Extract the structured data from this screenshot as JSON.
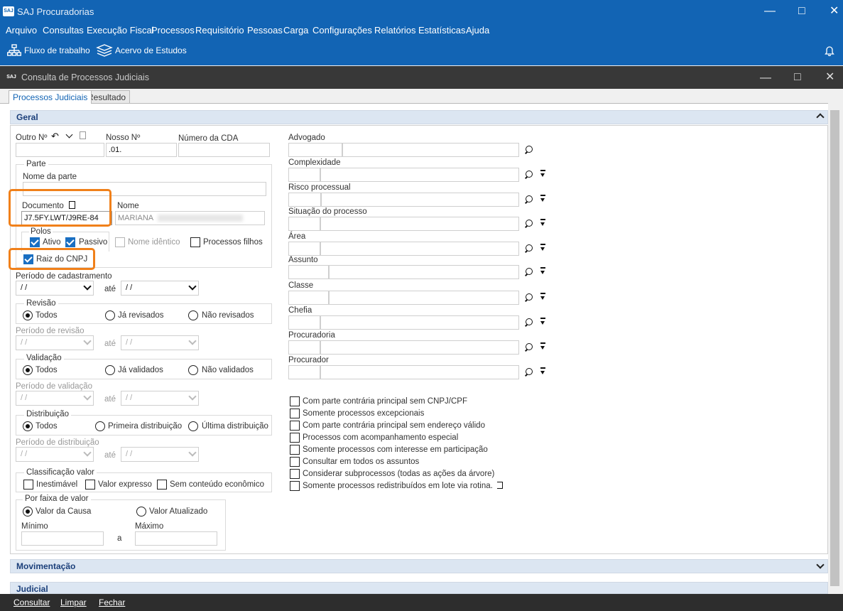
{
  "app": {
    "title": "SAJ Procuradorias",
    "logo_text": "SAJ"
  },
  "menu": [
    "Arquivo",
    "Consultas",
    "Execução Fiscal",
    "Processos",
    "Requisitório",
    "Pessoas",
    "Carga",
    "Configurações",
    "Relatórios",
    "Estatísticas",
    "Ajuda"
  ],
  "toolbar": {
    "fluxo": "Fluxo de trabalho",
    "acervo": "Acervo de Estudos"
  },
  "child": {
    "title": "Consulta de Processos Judiciais"
  },
  "tabs": [
    "Processos Judiciais",
    "Resultado"
  ],
  "sections": {
    "geral": "Geral",
    "movimentacao": "Movimentação",
    "judicial": "Judicial"
  },
  "left": {
    "outro_no": "Outro Nº",
    "nosso_no": "Nosso Nº",
    "nosso_val": ".01.",
    "numero_cda": "Número da CDA",
    "parte": "Parte",
    "nome_parte": "Nome da parte",
    "documento": "Documento",
    "documento_val": "J7.5FY.LWT/J9RE-84",
    "nome": "Nome",
    "nome_val": "MARIANA",
    "polos": "Polos",
    "ativo": "Ativo",
    "passivo": "Passivo",
    "nome_identico": "Nome idêntico",
    "processos_filhos": "Processos filhos",
    "raiz_cnpj": "Raiz do CNPJ",
    "periodo_cad": "Período de cadastramento",
    "date_blank": "/ /",
    "ate": "até",
    "revisao": "Revisão",
    "todos": "Todos",
    "ja_revisados": "Já revisados",
    "nao_revisados": "Não revisados",
    "periodo_rev": "Período de revisão",
    "validacao": "Validação",
    "ja_validados": "Já validados",
    "nao_validados": "Não validados",
    "periodo_val": "Período de validação",
    "distribuicao": "Distribuição",
    "primeira_dist": "Primeira distribuição",
    "ultima_dist": "Última distribuição",
    "periodo_dist": "Período de distribuição",
    "class_valor": "Classificação valor",
    "inestimavel": "Inestimável",
    "valor_expresso": "Valor expresso",
    "sem_conteudo": "Sem conteúdo econômico",
    "faixa_valor": "Por faixa de valor",
    "valor_causa": "Valor da Causa",
    "valor_atualizado": "Valor Atualizado",
    "minimo": "Mínimo",
    "maximo": "Máximo",
    "a": "a"
  },
  "right": {
    "fields": [
      "Advogado",
      "Complexidade",
      "Risco processual",
      "Situação do processo",
      "Área",
      "Assunto",
      "Classe",
      "Chefia",
      "Procuradoria",
      "Procurador"
    ],
    "checks": [
      "Com parte contrária principal sem CNPJ/CPF",
      "Somente processos excepcionais",
      "Com parte contrária principal sem endereço válido",
      "Processos com acompanhamento especial",
      "Somente processos com interesse em participação",
      "Consultar em todos os assuntos",
      "Considerar subprocessos (todas as ações da árvore)",
      "Somente processos redistribuídos em lote via rotina."
    ]
  },
  "bottom": {
    "consultar": "Consultar",
    "limpar": "Limpar",
    "fechar": "Fechar"
  }
}
